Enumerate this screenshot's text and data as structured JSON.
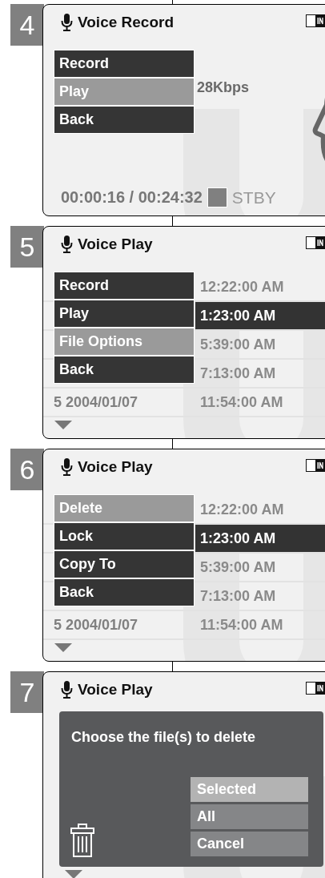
{
  "screens": [
    {
      "step": "4",
      "kind": "record",
      "title": "Voice Record",
      "menu": [
        {
          "label": "Record",
          "selected": false
        },
        {
          "label": "Play",
          "selected": true
        },
        {
          "label": "Back",
          "selected": false
        }
      ],
      "bitrate": "28Kbps",
      "time": "00:00:16 / 00:24:32",
      "status": "STBY"
    },
    {
      "step": "5",
      "kind": "list",
      "title": "Voice Play",
      "menu": [
        {
          "label": "Record",
          "selected": false
        },
        {
          "label": "Play",
          "selected": false
        },
        {
          "label": "File Options",
          "selected": true
        },
        {
          "label": "Back",
          "selected": false
        }
      ],
      "rows": [
        {
          "time": "12:22:00 AM",
          "selected": false
        },
        {
          "time": "1:23:00 AM",
          "selected": true
        },
        {
          "time": "5:39:00 AM",
          "selected": false
        },
        {
          "time": "7:13:00 AM",
          "selected": false
        },
        {
          "date": "5 2004/01/07",
          "time": "11:54:00 AM",
          "selected": false
        }
      ]
    },
    {
      "step": "6",
      "kind": "list",
      "title": "Voice Play",
      "menu": [
        {
          "label": "Delete",
          "selected": true
        },
        {
          "label": "Lock",
          "selected": false
        },
        {
          "label": "Copy To",
          "selected": false
        },
        {
          "label": "Back",
          "selected": false
        }
      ],
      "rows": [
        {
          "time": "12:22:00 AM",
          "selected": false
        },
        {
          "time": "1:23:00 AM",
          "selected": true
        },
        {
          "time": "5:39:00 AM",
          "selected": false
        },
        {
          "time": "7:13:00 AM",
          "selected": false
        },
        {
          "date": "5 2004/01/07",
          "time": "11:54:00 AM",
          "selected": false
        }
      ]
    },
    {
      "step": "7",
      "kind": "dialog",
      "title": "Voice Play",
      "dialog": {
        "message": "Choose the file(s) to delete",
        "options": [
          {
            "label": "Selected",
            "selected": true
          },
          {
            "label": "All",
            "selected": false
          },
          {
            "label": "Cancel",
            "selected": false
          }
        ]
      }
    }
  ]
}
